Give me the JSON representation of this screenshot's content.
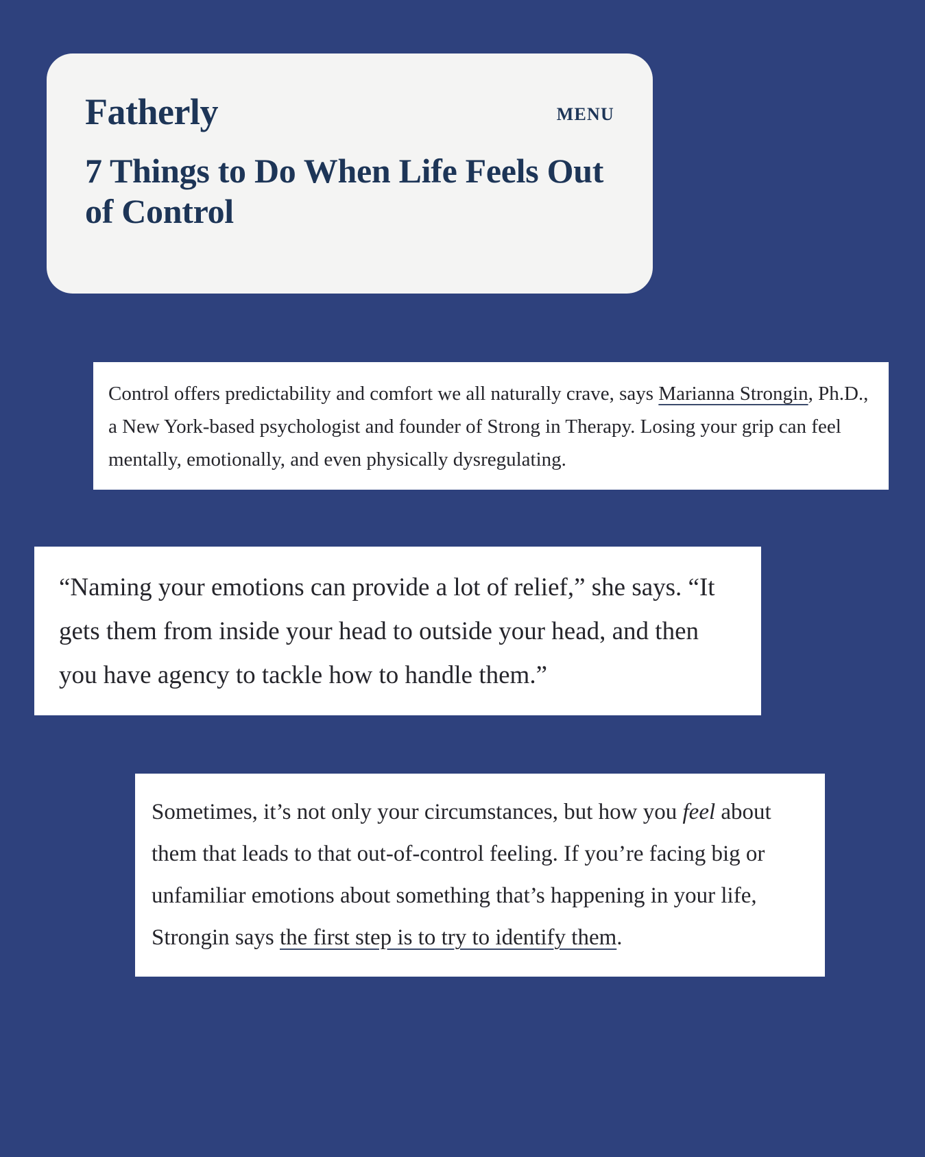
{
  "page": {
    "background_color": "#2e417d",
    "card_color": "#f4f4f3",
    "block_color": "#ffffff",
    "text_color": "#25252b",
    "brand_color": "#1d3557"
  },
  "header": {
    "brand": "Fatherly",
    "menu_label": "MENU",
    "headline": "7 Things to Do When Life Feels Out of Control"
  },
  "blocks": {
    "intro": {
      "lead": "Control offers predictability and comfort we all naturally crave, says ",
      "link": "Marianna Strongin",
      "rest": ", Ph.D., a New York-based psychologist and founder of Strong in Therapy. Losing your grip can feel mentally, emotionally, and even physically dysregulating."
    },
    "pullquote": {
      "text": "“Naming your emotions can provide a lot of relief,” she says. “It gets them from inside your head to outside your head, and then you have agency to tackle how to handle them.”"
    },
    "closing": {
      "part_one": "Sometimes, it’s not only your circumstances, but how you ",
      "italic": "feel",
      "part_two": " about them that leads to that out-of-control feeling. If you’re facing big or unfamiliar emotions about something that’s happening in your life, Strongin says ",
      "link": "the first step is to try to identify them",
      "part_three": "."
    }
  }
}
